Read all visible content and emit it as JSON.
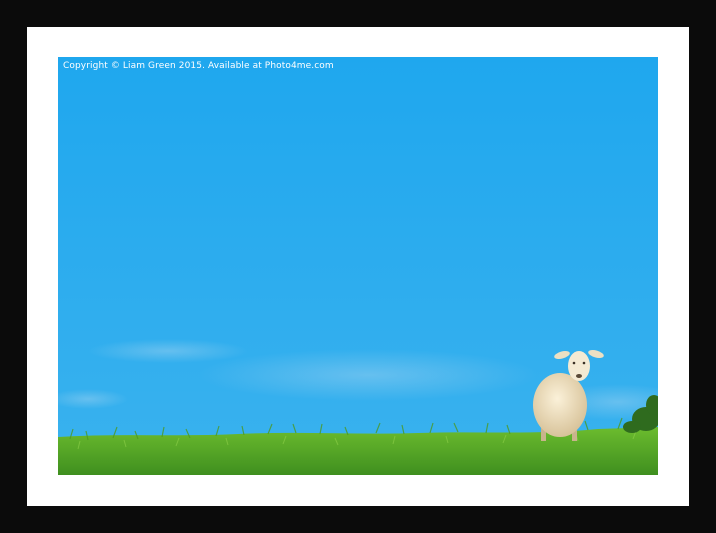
{
  "photo": {
    "copyright": "Copyright © Liam Green 2015. Available at Photo4me.com",
    "colors": {
      "frame": "#0b0b0b",
      "mount": "#ffffff",
      "sky_top": "#21a9ee",
      "sky_bottom": "#3bb0ec",
      "grass_light": "#5fb22a",
      "grass_dark": "#2f7a18",
      "sheep": "#f1e4c7"
    }
  }
}
